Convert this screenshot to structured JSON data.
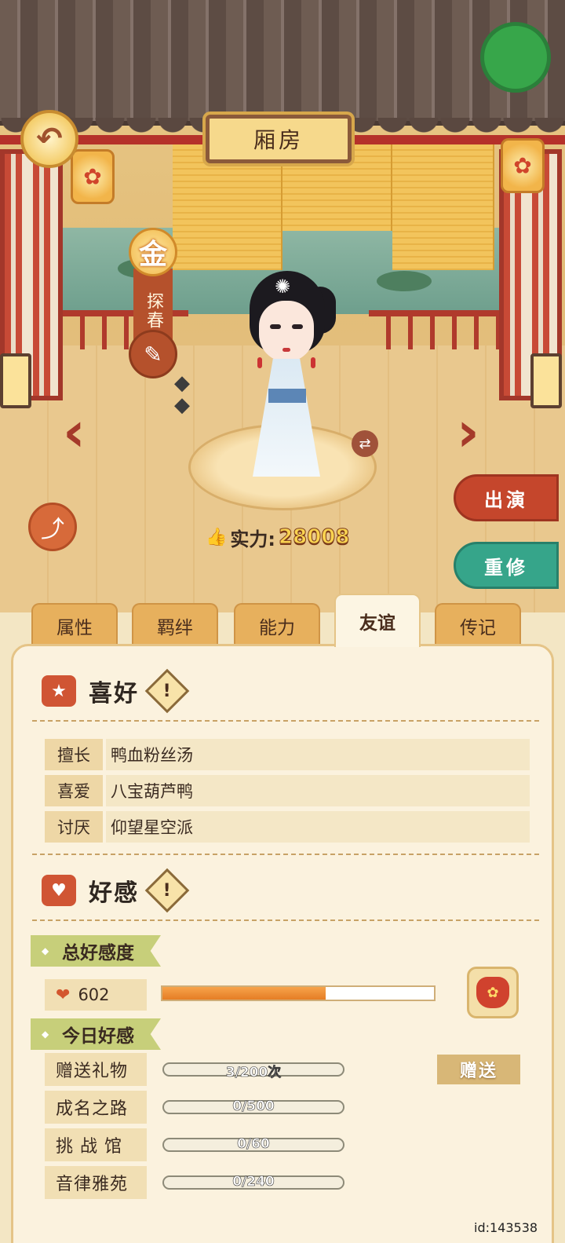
{
  "header": {
    "title": "厢房"
  },
  "character": {
    "rank": "金",
    "name": "探春",
    "power_label": "实力:",
    "power_value": "28008"
  },
  "buttons": {
    "perform": "出演",
    "retrain": "重修"
  },
  "tabs": [
    {
      "label": "属性"
    },
    {
      "label": "羁绊"
    },
    {
      "label": "能力"
    },
    {
      "label": "友谊",
      "active": true
    },
    {
      "label": "传记"
    }
  ],
  "preferences": {
    "title": "喜好",
    "rows": [
      {
        "key": "擅长",
        "value": "鸭血粉丝汤"
      },
      {
        "key": "喜爱",
        "value": "八宝葫芦鸭"
      },
      {
        "key": "讨厌",
        "value": "仰望星空派"
      }
    ]
  },
  "favor": {
    "title": "好感",
    "total_label": "总好感度",
    "total_value": "602",
    "total_fraction": 0.6,
    "today_label": "今日好感",
    "gift_button": "赠送",
    "today_rows": [
      {
        "key": "赠送礼物",
        "progress": "3/200次"
      },
      {
        "key": "成名之路",
        "progress": "0/500"
      },
      {
        "key": "挑 战 馆",
        "progress": "0/60"
      },
      {
        "key": "音律雅苑",
        "progress": "0/240"
      }
    ]
  },
  "footer": {
    "uid": "id:143538"
  },
  "colors": {
    "accent_red": "#c5462c",
    "accent_green": "#36a58a",
    "bar_fill": "#e57d25"
  }
}
